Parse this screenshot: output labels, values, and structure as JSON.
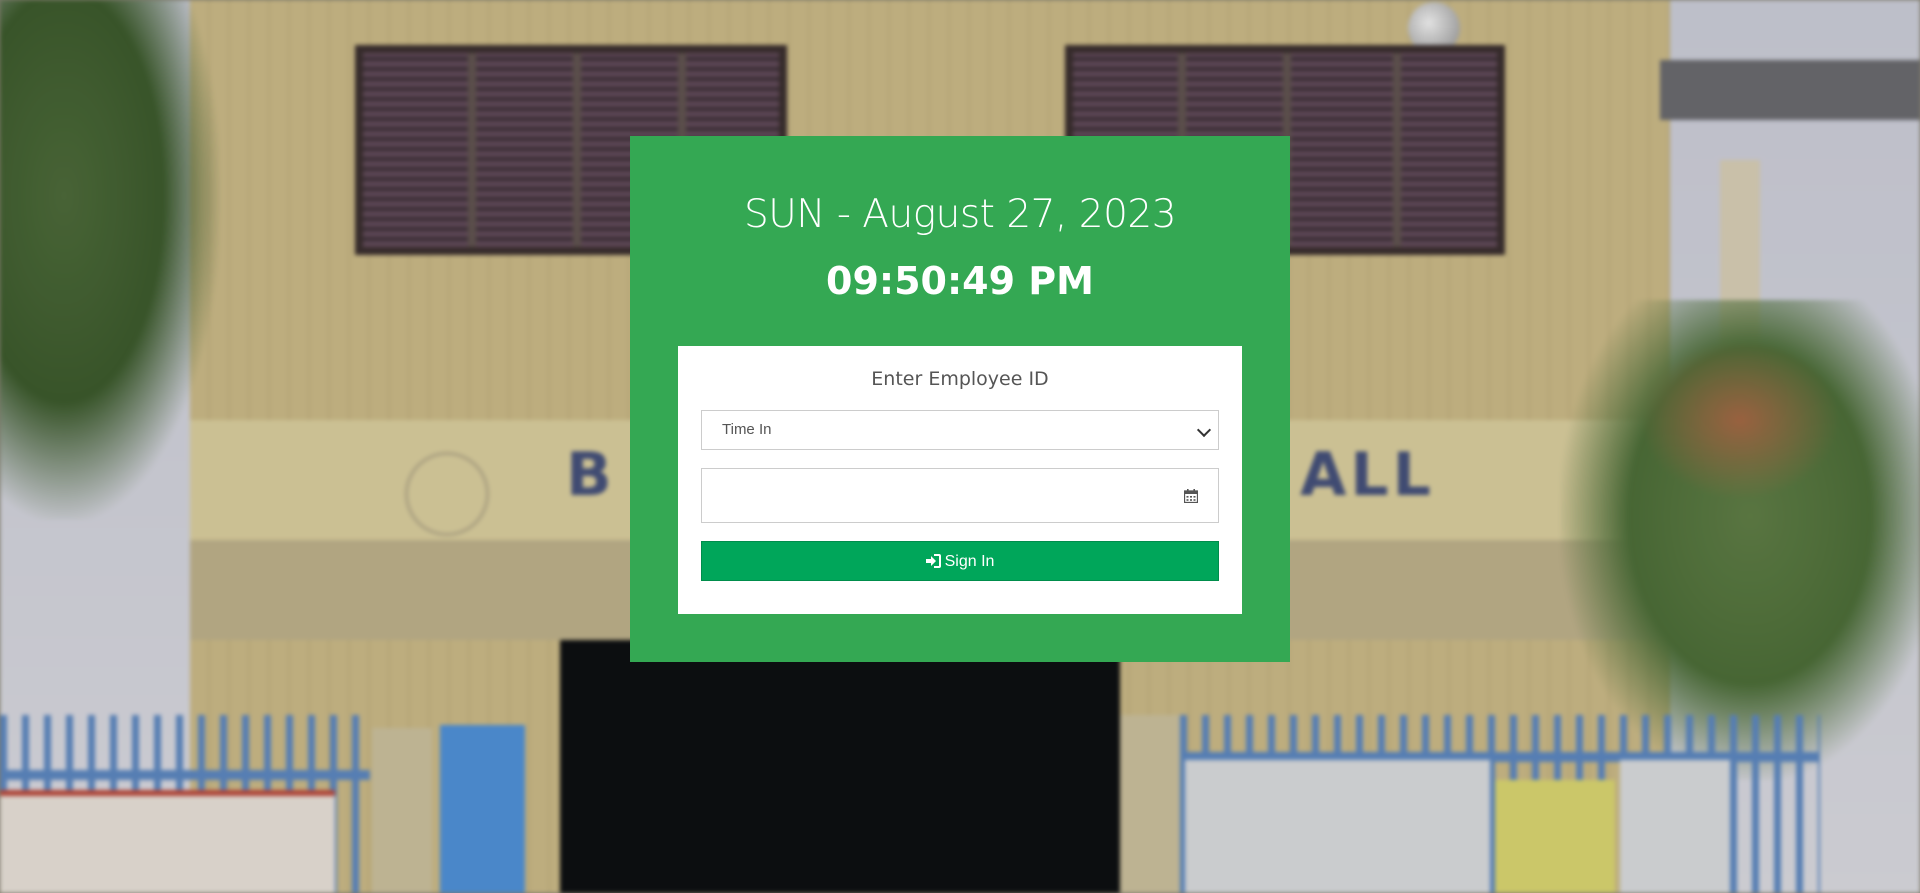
{
  "header": {
    "date": "SUN - August 27, 2023",
    "time": "09:50:49 PM"
  },
  "form": {
    "title": "Enter Employee ID",
    "mode_select": {
      "selected": "Time In"
    },
    "employee_input": {
      "value": ""
    },
    "submit_label": "Sign In"
  },
  "icons": {
    "select_chevron": "chevron-down-icon",
    "input_icon": "calendar-icon",
    "button_icon": "sign-in-icon"
  },
  "colors": {
    "panel_bg": "#34a853",
    "button_bg": "#00a65a"
  },
  "background": {
    "sign_letters_left": "B",
    "sign_letters_right": "ALL"
  }
}
